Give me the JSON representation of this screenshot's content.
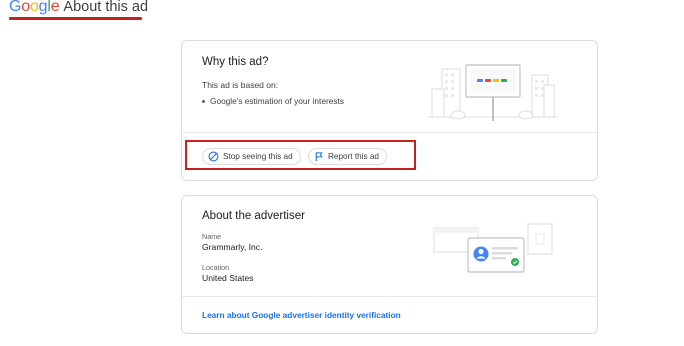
{
  "header": {
    "logo_letters": [
      {
        "ch": "G",
        "color": "#4285F4"
      },
      {
        "ch": "o",
        "color": "#EA4335"
      },
      {
        "ch": "o",
        "color": "#FBBC05"
      },
      {
        "ch": "g",
        "color": "#4285F4"
      },
      {
        "ch": "l",
        "color": "#34A853"
      },
      {
        "ch": "e",
        "color": "#EA4335"
      }
    ],
    "title": "About this ad",
    "underline_color": "#c5221f"
  },
  "why_card": {
    "title": "Why this ad?",
    "based_on": "This ad is based on:",
    "reasons": [
      "Google's estimation of your interests"
    ],
    "illustration": "billboard-city-illustration",
    "buttons": {
      "stop_label": "Stop seeing this ad",
      "stop_icon": "block-icon",
      "report_label": "Report this ad",
      "report_icon": "flag-icon"
    }
  },
  "advertiser_card": {
    "title": "About the advertiser",
    "name_label": "Name",
    "name_value": "Grammarly, Inc.",
    "location_label": "Location",
    "location_value": "United States",
    "illustration": "verified-id-card-illustration",
    "link_label": "Learn about Google advertiser identity verification"
  },
  "colors": {
    "accent_blue": "#1a73e8",
    "highlight_red": "#c5221f",
    "border": "#dadce0"
  }
}
